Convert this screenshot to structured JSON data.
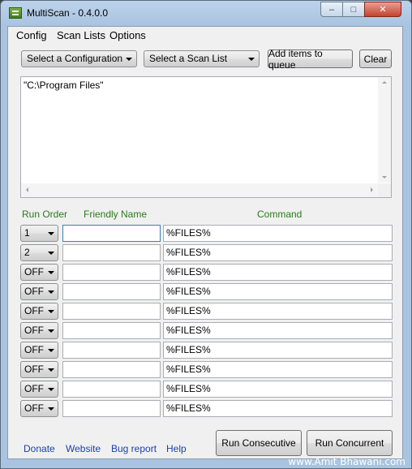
{
  "window": {
    "title": "MultiScan - 0.4.0.0",
    "controls": {
      "minimize_glyph": "–",
      "maximize_glyph": "□",
      "close_glyph": "✕"
    }
  },
  "menu": [
    {
      "label": "Config"
    },
    {
      "label": "Scan Lists"
    },
    {
      "label": "Options"
    }
  ],
  "toolbar": {
    "configuration_select": "Select a Configuration",
    "scan_list_select": "Select a Scan List",
    "add_button": "Add items to queue",
    "clear_button": "Clear"
  },
  "queue": {
    "text": "\"C:\\Program Files\""
  },
  "table": {
    "headers": {
      "run_order": "Run Order",
      "friendly_name": "Friendly Name",
      "command": "Command"
    },
    "rows": [
      {
        "order": "1",
        "name": "",
        "command": "%FILES%"
      },
      {
        "order": "2",
        "name": "",
        "command": "%FILES%"
      },
      {
        "order": "OFF",
        "name": "",
        "command": "%FILES%"
      },
      {
        "order": "OFF",
        "name": "",
        "command": "%FILES%"
      },
      {
        "order": "OFF",
        "name": "",
        "command": "%FILES%"
      },
      {
        "order": "OFF",
        "name": "",
        "command": "%FILES%"
      },
      {
        "order": "OFF",
        "name": "",
        "command": "%FILES%"
      },
      {
        "order": "OFF",
        "name": "",
        "command": "%FILES%"
      },
      {
        "order": "OFF",
        "name": "",
        "command": "%FILES%"
      },
      {
        "order": "OFF",
        "name": "",
        "command": "%FILES%"
      }
    ]
  },
  "footer": {
    "links": [
      "Donate",
      "Website",
      "Bug report",
      "Help"
    ],
    "run_consecutive": "Run Consecutive",
    "run_concurrent": "Run Concurrent"
  },
  "watermark": "www.Amit Bhawani.com",
  "colors": {
    "header_green": "#2a7a1a",
    "link_blue": "#1a3fb0"
  }
}
